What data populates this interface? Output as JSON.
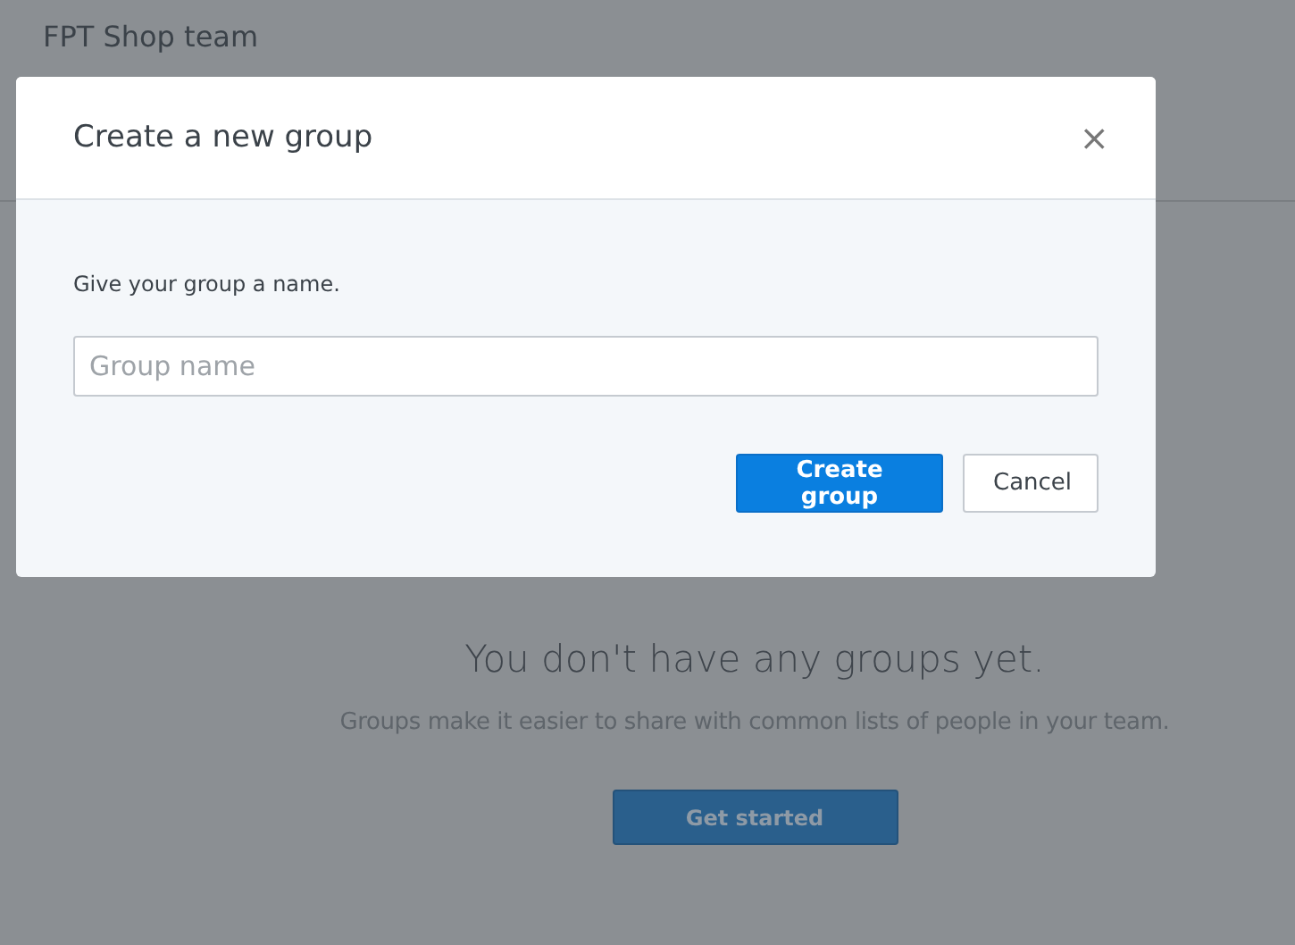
{
  "page": {
    "title": "FPT Shop team"
  },
  "empty_state": {
    "heading": "You don't have any groups yet.",
    "description": "Groups make it easier to share with common lists of people in your team.",
    "button": "Get started"
  },
  "dialog": {
    "title": "Create a new group",
    "close": "×",
    "prompt": "Give your group a name.",
    "field": {
      "placeholder": "Group name"
    },
    "buttons": [
      {
        "label": "Create group",
        "kind": "primary"
      },
      {
        "label": "Cancel",
        "kind": "secondary"
      }
    ]
  }
}
